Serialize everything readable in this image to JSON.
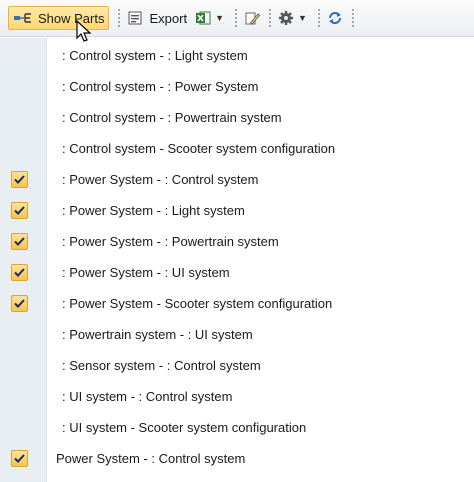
{
  "toolbar": {
    "show_parts_label": "Show Parts",
    "export_label": "Export"
  },
  "rows": [
    {
      "text": ": Control system -  : Light system",
      "checked": false
    },
    {
      "text": ": Control system -  : Power System",
      "checked": false
    },
    {
      "text": ": Control system -  : Powertrain system",
      "checked": false
    },
    {
      "text": ": Control system - Scooter system configuration",
      "checked": false
    },
    {
      "text": ": Power System -  : Control system",
      "checked": true
    },
    {
      "text": ": Power System -  : Light system",
      "checked": true
    },
    {
      "text": ": Power System -  : Powertrain system",
      "checked": true
    },
    {
      "text": ": Power System -  : UI system",
      "checked": true
    },
    {
      "text": ": Power System - Scooter system configuration",
      "checked": true
    },
    {
      "text": ": Powertrain system -  : UI system",
      "checked": false
    },
    {
      "text": ": Sensor system -  : Control system",
      "checked": false
    },
    {
      "text": ": UI system -  : Control system",
      "checked": false
    },
    {
      "text": ": UI system - Scooter system configuration",
      "checked": false
    },
    {
      "text": "Power System -  : Control system",
      "checked": true
    }
  ],
  "colors": {
    "check_fill": "#f7c548",
    "show_parts_bg": "#ffd870",
    "gutter": "#e9eef2"
  }
}
